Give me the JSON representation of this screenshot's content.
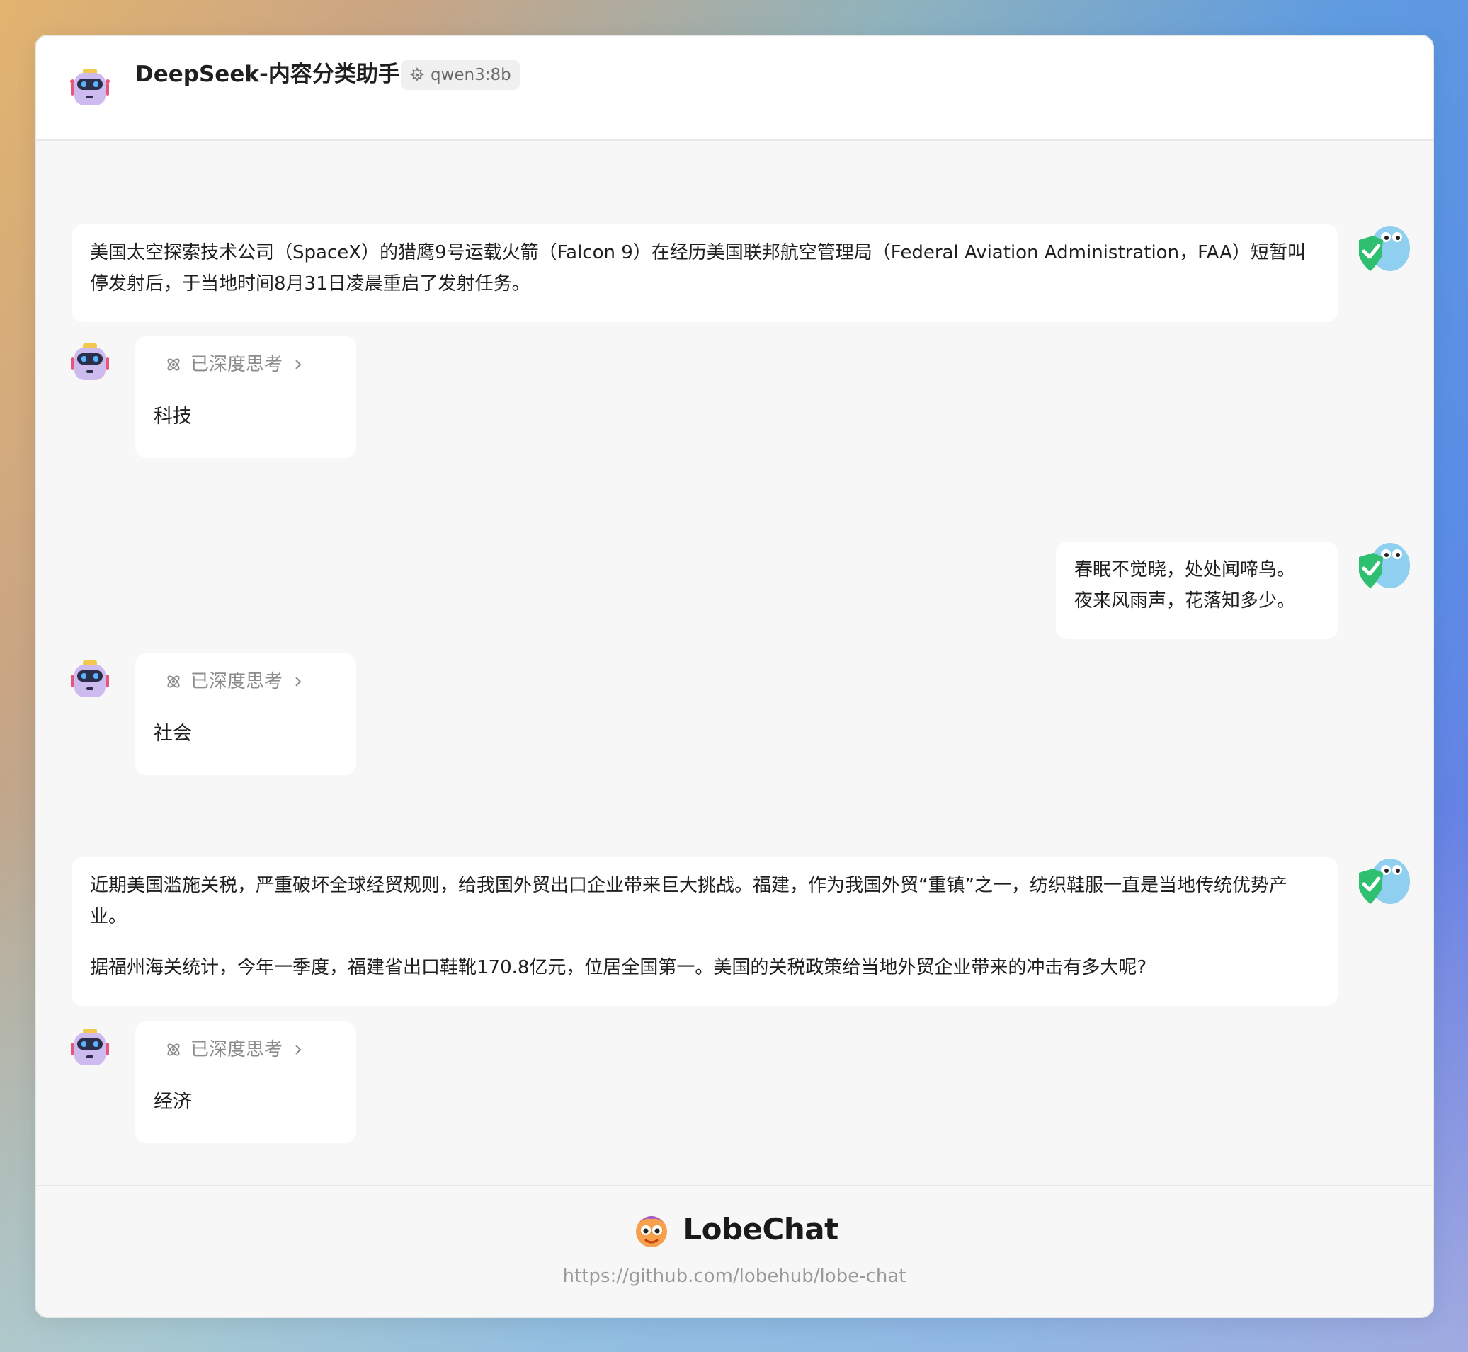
{
  "header": {
    "title": "DeepSeek-内容分类助手",
    "model": "qwen3:8b",
    "model_icon": "ollama-icon"
  },
  "messages": [
    {
      "role": "user",
      "paragraphs": [
        "美国太空探索技术公司（SpaceX）的猎鹰9号运载火箭（Falcon 9）在经历美国联邦航空管理局（Federal Aviation Administration，FAA）短暂叫停发射后，于当地时间8月31日凌晨重启了发射任务。"
      ]
    },
    {
      "role": "assistant",
      "thinking_label": "已深度思考",
      "answer": "科技"
    },
    {
      "role": "user",
      "lines": [
        "春眠不觉晓，处处闻啼鸟。",
        "夜来风雨声，花落知多少。"
      ]
    },
    {
      "role": "assistant",
      "thinking_label": "已深度思考",
      "answer": "社会"
    },
    {
      "role": "user",
      "paragraphs": [
        "近期美国滥施关税，严重破坏全球经贸规则，给我国外贸出口企业带来巨大挑战。福建，作为我国外贸“重镇”之一，纺织鞋服一直是当地传统优势产业。",
        "据福州海关统计，今年一季度，福建省出口鞋靴170.8亿元，位居全国第一。美国的关税政策给当地外贸企业带来的冲击有多大呢?"
      ]
    },
    {
      "role": "assistant",
      "thinking_label": "已深度思考",
      "answer": "经济"
    }
  ],
  "footer": {
    "brand": "LobeChat",
    "url": "https://github.com/lobehub/lobe-chat"
  },
  "colors": {
    "accent_green": "#2fbf71",
    "robot_purple": "#c8b6ea",
    "gopher_blue": "#8fd0f0"
  }
}
